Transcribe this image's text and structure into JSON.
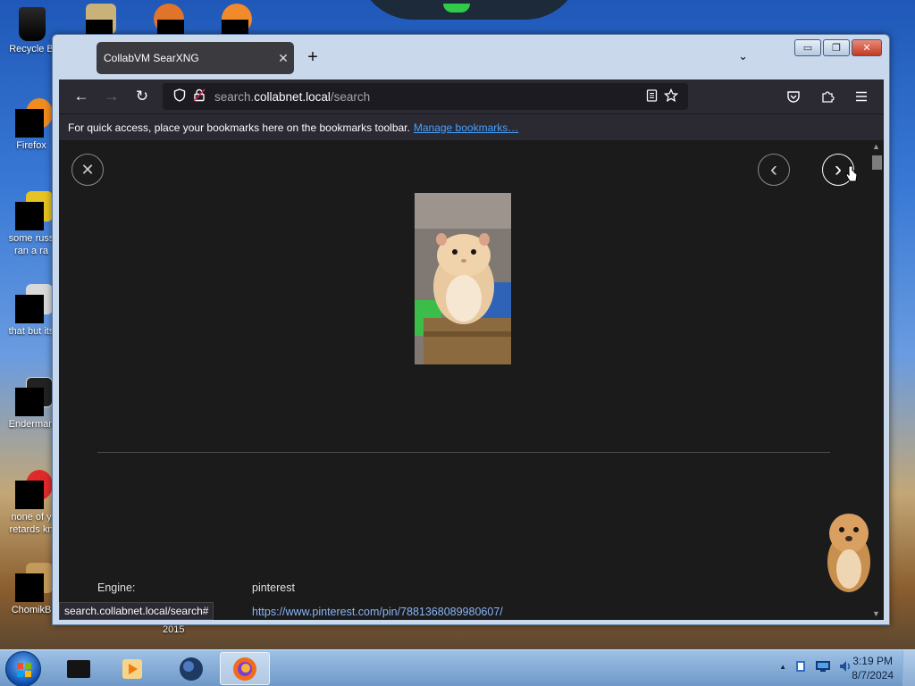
{
  "desktop": {
    "icons": [
      {
        "label": "Recycle B",
        "icon": "recycle-bin-icon"
      },
      {
        "label": "Firefox",
        "icon": "firefox-icon"
      },
      {
        "label": "some russ",
        "label2": "ran a ra",
        "icon": "document-icon"
      },
      {
        "label": "that but its",
        "icon": "stacked-windows-icon"
      },
      {
        "label": "Enderman",
        "icon": "window-icon"
      },
      {
        "label": "none of y",
        "label2": "retards kn",
        "icon": "opera-icon"
      },
      {
        "label": "ChomikB",
        "icon": "hamster-icon"
      }
    ],
    "year_label": "2015"
  },
  "window": {
    "tab_title": "CollabVM SearXNG",
    "tab_close": "✕",
    "new_tab": "+",
    "tab_list": "⌄",
    "controls": {
      "minimize": "▭",
      "maximize": "❐",
      "close": "✕"
    }
  },
  "navbar": {
    "back": "←",
    "forward": "→",
    "reload": "↻",
    "url_host": "search.",
    "url_domain": "collabnet.local",
    "url_path": "/search"
  },
  "bookmarks_bar": {
    "message": "For quick access, place your bookmarks here on the bookmarks toolbar.",
    "link": "Manage bookmarks…"
  },
  "viewer": {
    "close": "✕",
    "prev": "‹",
    "next": "›",
    "engine_label": "Engine:",
    "engine_value": "pinterest",
    "result_url": "https://www.pinterest.com/pin/7881368089980607/"
  },
  "statusbar": {
    "text": "search.collabnet.local/search#"
  },
  "taskbar": {
    "time": "3:19 PM",
    "date": "8/7/2024",
    "tray_show_hidden": "▲"
  }
}
